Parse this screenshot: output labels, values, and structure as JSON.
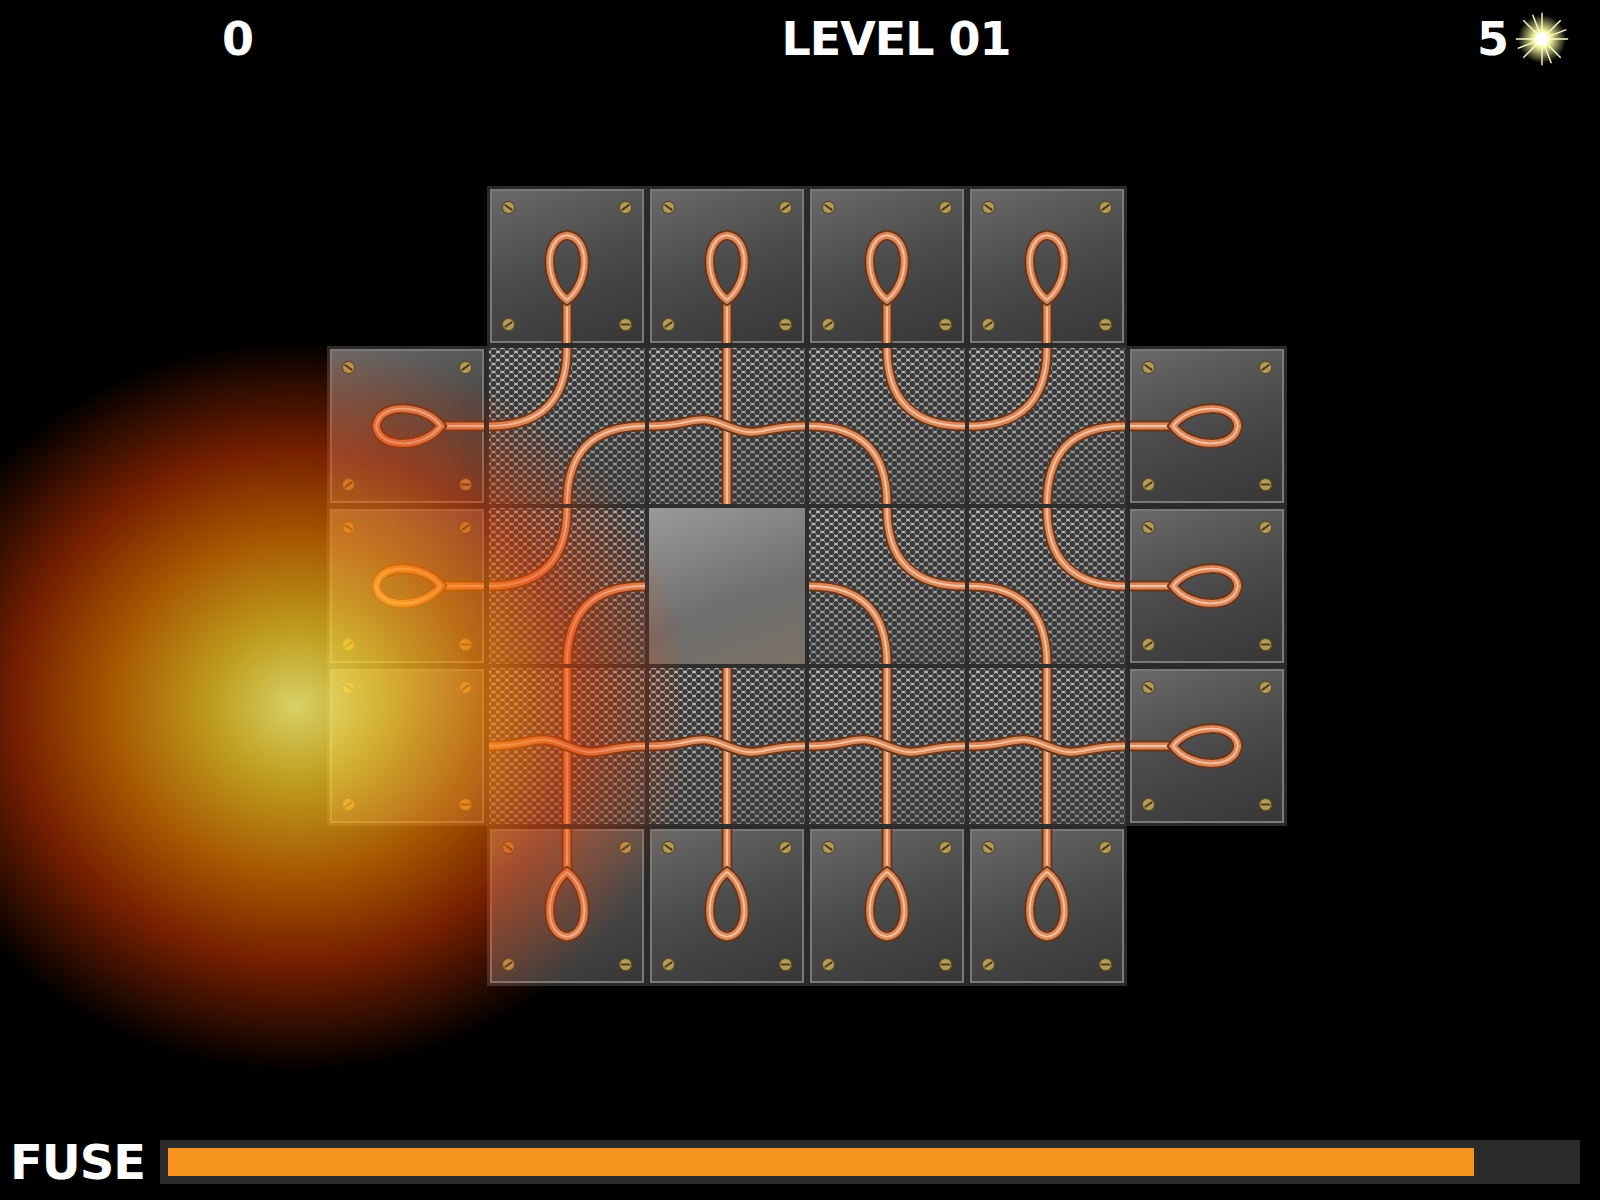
{
  "hud": {
    "score": "0",
    "level": "LEVEL 01",
    "lives": "5"
  },
  "board": {
    "rows": [
      [
        {
          "kind": "empty"
        },
        {
          "kind": "terminal",
          "facing": "S"
        },
        {
          "kind": "terminal",
          "facing": "S"
        },
        {
          "kind": "terminal",
          "facing": "S"
        },
        {
          "kind": "terminal",
          "facing": "S"
        },
        {
          "kind": "empty"
        }
      ],
      [
        {
          "kind": "terminal",
          "facing": "E"
        },
        {
          "kind": "mesh",
          "pipes": [
            "N-W",
            "E-S"
          ]
        },
        {
          "kind": "mesh",
          "pipes": [
            "cross"
          ]
        },
        {
          "kind": "mesh",
          "pipes": [
            "W-S",
            "N-E"
          ]
        },
        {
          "kind": "mesh",
          "pipes": [
            "N-W",
            "E-S"
          ]
        },
        {
          "kind": "terminal",
          "facing": "W"
        }
      ],
      [
        {
          "kind": "terminal",
          "facing": "E"
        },
        {
          "kind": "mesh",
          "pipes": [
            "N-W",
            "E-S"
          ]
        },
        {
          "kind": "steel"
        },
        {
          "kind": "mesh",
          "pipes": [
            "N-E",
            "W-S"
          ]
        },
        {
          "kind": "mesh",
          "pipes": [
            "N-E",
            "W-S"
          ]
        },
        {
          "kind": "terminal",
          "facing": "W"
        }
      ],
      [
        {
          "kind": "metal"
        },
        {
          "kind": "mesh",
          "pipes": [
            "cross"
          ]
        },
        {
          "kind": "mesh",
          "pipes": [
            "cross"
          ]
        },
        {
          "kind": "mesh",
          "pipes": [
            "cross"
          ]
        },
        {
          "kind": "mesh",
          "pipes": [
            "cross"
          ]
        },
        {
          "kind": "terminal",
          "facing": "W"
        }
      ],
      [
        {
          "kind": "empty"
        },
        {
          "kind": "terminal",
          "facing": "N"
        },
        {
          "kind": "terminal",
          "facing": "N"
        },
        {
          "kind": "terminal",
          "facing": "N"
        },
        {
          "kind": "terminal",
          "facing": "N"
        },
        {
          "kind": "empty"
        }
      ]
    ]
  },
  "explosion": {
    "visible": true
  },
  "fuse": {
    "label": "FUSE",
    "level": 0.93
  }
}
